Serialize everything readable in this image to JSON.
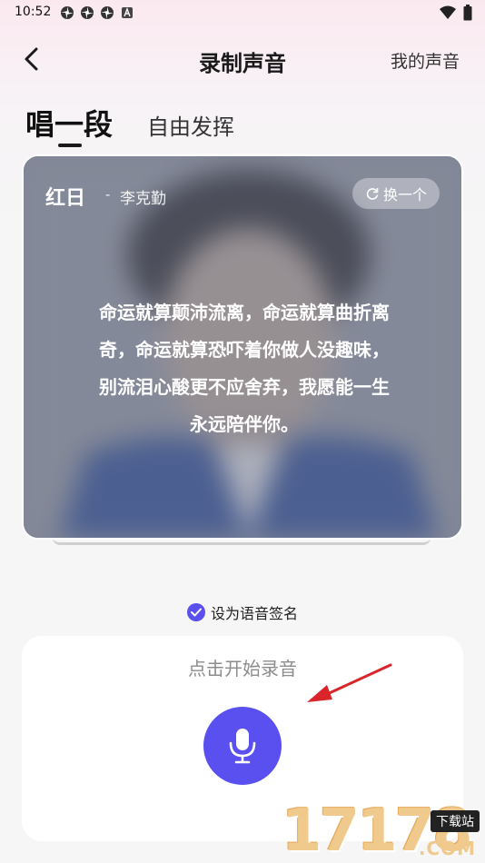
{
  "status_bar": {
    "time": "10:52",
    "notification_icons": [
      "pinwheel-icon",
      "pinwheel-icon",
      "pinwheel-icon",
      "a-badge-icon"
    ],
    "right_icons": [
      "wifi-icon",
      "battery-icon"
    ]
  },
  "header": {
    "title": "录制声音",
    "back_icon": "chevron-left-icon",
    "right_link": "我的声音"
  },
  "tabs": {
    "items": [
      {
        "label": "唱一段",
        "active": true
      },
      {
        "label": "自由发挥",
        "active": false
      }
    ]
  },
  "song_card": {
    "title": "红日",
    "separator": "-",
    "artist": "李克勤",
    "swap_button": "换一个",
    "swap_icon": "refresh-icon",
    "lyrics": [
      "命运就算颠沛流离，命运就算曲折离",
      "奇，命运就算恐吓着你做人没趣味，",
      "别流泪心酸更不应舍弃，我愿能一生",
      "永远陪伴你。"
    ]
  },
  "signature": {
    "label": "设为语音签名",
    "checked": true
  },
  "record_panel": {
    "hint": "点击开始录音",
    "mic_icon": "microphone-icon"
  },
  "watermark": {
    "number": "17178",
    "badge": "下载站",
    "domain": ".COM"
  },
  "colors": {
    "accent": "#5a50f0",
    "arrow": "#d9262b",
    "panel_bg": "#ffffff",
    "page_bg": "#f6f6f6"
  }
}
